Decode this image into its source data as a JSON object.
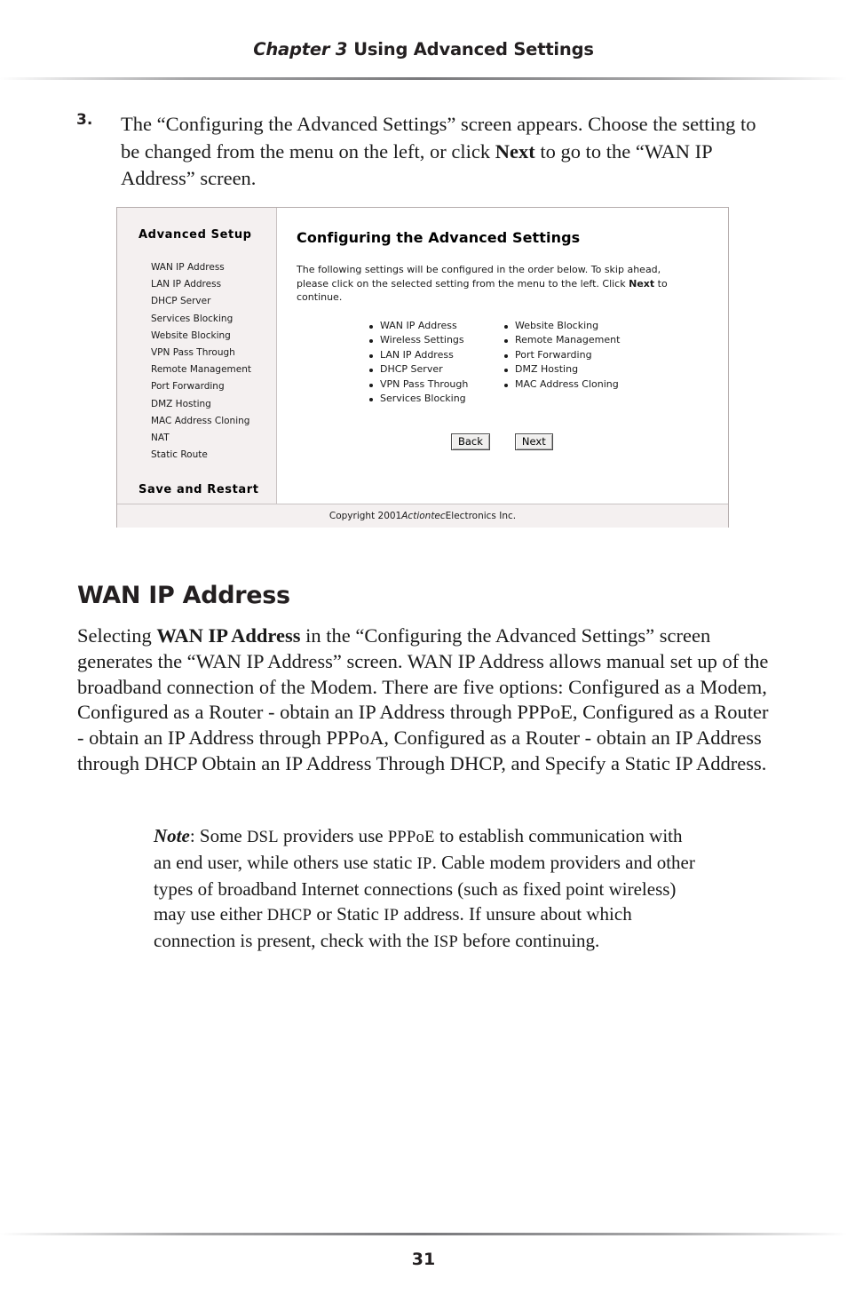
{
  "page": {
    "running_head_chapter": "Chapter 3",
    "running_head_title": "Using Advanced Settings",
    "page_number": "31"
  },
  "step": {
    "number": "3.",
    "text_part1": "The “Configuring the Advanced Settings” screen appears. Choose the setting to be changed from the menu on the left, or click ",
    "bold_word": "Next",
    "text_part2": " to go to the “WAN IP Address” screen."
  },
  "figure": {
    "sidebar": {
      "title": "Advanced Setup",
      "items": [
        "WAN IP Address",
        "LAN IP Address",
        "DHCP Server",
        "Services Blocking",
        "Website Blocking",
        "VPN Pass Through",
        "Remote Management",
        "Port Forwarding",
        "DMZ Hosting",
        "MAC Address Cloning",
        "NAT",
        "Static Route"
      ],
      "footer_link": "Save and Restart"
    },
    "content": {
      "heading": "Configuring the Advanced Settings",
      "intro_part1": "The following settings will be configured in the order below. To skip ahead, please click on the selected setting from the menu to the left. Click ",
      "intro_bold": "Next",
      "intro_part2": " to continue.",
      "column_left": [
        "WAN IP Address",
        "Wireless Settings",
        "LAN IP Address",
        "DHCP Server",
        "VPN Pass Through",
        "Services Blocking"
      ],
      "column_right": [
        "Website Blocking",
        "Remote Management",
        "Port Forwarding",
        "DMZ Hosting",
        "MAC Address Cloning"
      ],
      "back_button": "Back",
      "next_button": "Next"
    },
    "footer": {
      "copyright_prefix": "Copyright 2001 ",
      "copyright_brand": "Actiontec",
      "copyright_suffix": " Electronics Inc."
    }
  },
  "section": {
    "heading": "WAN IP Address",
    "body_part1": "Selecting ",
    "body_bold": "WAN IP Address",
    "body_part2": " in the “Configuring the Advanced Settings” screen generates the “WAN IP Address” screen. WAN IP Address allows manual set up of the broadband connection of the Modem. There are five options: Configured as a Modem, Configured as a Router - obtain an IP Address through PPPoE, Configured as a Router - obtain an IP Address through PPPoA, Configured as a Router - obtain an IP Address through DHCP Obtain an IP Address Through DHCP, and Specify a Static IP Address."
  },
  "note": {
    "label": "Note",
    "seg1": ": Some ",
    "sc1": "DSL",
    "seg2": " providers use ",
    "sc2": "PPPoE",
    "seg3": " to establish communication with an end user, while others use static ",
    "sc3": "IP",
    "seg4": ". Cable modem providers and other types of broadband Internet connections (such as fixed point wireless) may use either ",
    "sc4": "DHCP",
    "seg5": " or Static ",
    "sc5": "IP",
    "seg6": " address. If unsure about which connection is present, check with the ",
    "sc6": "ISP",
    "seg7": " before continuing."
  },
  "colors": {
    "text": "#231f20",
    "panel_bg": "#f4f0f0",
    "panel_border": "#b5adad"
  }
}
